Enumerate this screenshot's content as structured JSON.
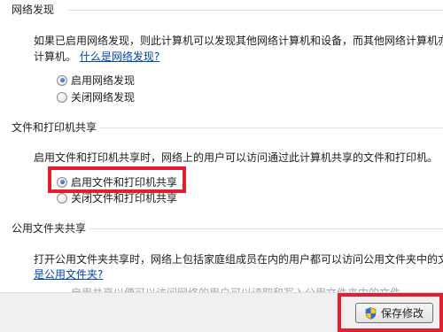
{
  "network_discovery": {
    "title": "网络发现",
    "description_line1": "如果已启用网络发现，则此计算机可以发现其他网络计算机和设备，而其他网络计算机亦",
    "description_line2": "计算机。",
    "help_link": "什么是网络发现?",
    "options": [
      {
        "label": "启用网络发现",
        "checked": true
      },
      {
        "label": "关闭网络发现",
        "checked": false
      }
    ]
  },
  "file_printer_sharing": {
    "title": "文件和打印机共享",
    "description": "启用文件和打印机共享时，网络上的用户可以访问通过此计算机共享的文件和打印机。",
    "options": [
      {
        "label": "启用文件和打印机共享",
        "checked": true
      },
      {
        "label": "关闭文件和打印机共享",
        "checked": false
      }
    ]
  },
  "public_folder_sharing": {
    "title": "公用文件夹共享",
    "description": "打开公用文件夹共享时，网络上包括家庭组成员在内的用户都可以访问公用文件夹中的文",
    "help_link": "是公用文件夹?",
    "faded_text": "启用共享以便可以访问网络的用户可以读取和写入公用文件夹中的文件"
  },
  "footer": {
    "save_label": "保存修改"
  },
  "colors": {
    "highlight": "#e0202e",
    "link": "#0645ad"
  }
}
